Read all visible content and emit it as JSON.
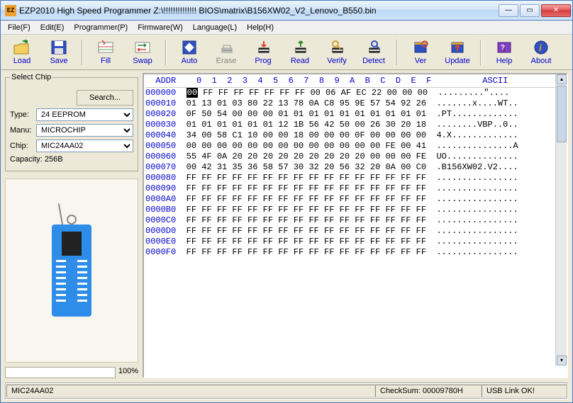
{
  "title": "EZP2010 High Speed Programmer   Z:\\!!!!!!!!!!!!!! BIOS\\matrix\\B156XW02_V2_Lenovo_B550.bin",
  "menu": [
    "File(F)",
    "Edit(E)",
    "Programmer(P)",
    "Firmware(W)",
    "Language(L)",
    "Help(H)"
  ],
  "tools": {
    "load": "Load",
    "save": "Save",
    "fill": "Fill",
    "swap": "Swap",
    "auto": "Auto",
    "erase": "Erase",
    "prog": "Prog",
    "read": "Read",
    "verify": "Verify",
    "detect": "Detect",
    "ver": "Ver",
    "update": "Update",
    "help": "Help",
    "about": "About"
  },
  "select": {
    "legend": "Select Chip",
    "search": "Search...",
    "type_label": "Type:",
    "type": "24 EEPROM",
    "manu_label": "Manu:",
    "manu": "MICROCHIP",
    "chip_label": "Chip:",
    "chip": "MIC24AA02",
    "capacity": "Capacity: 256B"
  },
  "progress": "100%",
  "hex": {
    "header": [
      "ADDR",
      "0",
      "1",
      "2",
      "3",
      "4",
      "5",
      "6",
      "7",
      "8",
      "9",
      "A",
      "B",
      "C",
      "D",
      "E",
      "F",
      "ASCII"
    ],
    "rows": [
      {
        "a": "000000",
        "b": [
          "00",
          "FF",
          "FF",
          "FF",
          "FF",
          "FF",
          "FF",
          "FF",
          "00",
          "06",
          "AF",
          "EC",
          "22",
          "00",
          "00",
          "00"
        ],
        "t": ".........\"...."
      },
      {
        "a": "000010",
        "b": [
          "01",
          "13",
          "01",
          "03",
          "80",
          "22",
          "13",
          "78",
          "0A",
          "C8",
          "95",
          "9E",
          "57",
          "54",
          "92",
          "26"
        ],
        "t": ".......x....WT.."
      },
      {
        "a": "000020",
        "b": [
          "0F",
          "50",
          "54",
          "00",
          "00",
          "00",
          "01",
          "01",
          "01",
          "01",
          "01",
          "01",
          "01",
          "01",
          "01",
          "01"
        ],
        "t": ".PT............."
      },
      {
        "a": "000030",
        "b": [
          "01",
          "01",
          "01",
          "01",
          "01",
          "01",
          "12",
          "1B",
          "56",
          "42",
          "50",
          "00",
          "26",
          "30",
          "20",
          "18"
        ],
        "t": "........VBP..0.."
      },
      {
        "a": "000040",
        "b": [
          "34",
          "00",
          "58",
          "C1",
          "10",
          "00",
          "00",
          "18",
          "00",
          "00",
          "00",
          "0F",
          "00",
          "00",
          "00",
          "00"
        ],
        "t": "4.X............."
      },
      {
        "a": "000050",
        "b": [
          "00",
          "00",
          "00",
          "00",
          "00",
          "00",
          "00",
          "00",
          "00",
          "00",
          "00",
          "00",
          "00",
          "FE",
          "00",
          "41"
        ],
        "t": "...............A"
      },
      {
        "a": "000060",
        "b": [
          "55",
          "4F",
          "0A",
          "20",
          "20",
          "20",
          "20",
          "20",
          "20",
          "20",
          "20",
          "20",
          "00",
          "00",
          "00",
          "FE"
        ],
        "t": "UO.............."
      },
      {
        "a": "000070",
        "b": [
          "00",
          "42",
          "31",
          "35",
          "36",
          "58",
          "57",
          "30",
          "32",
          "20",
          "56",
          "32",
          "20",
          "0A",
          "00",
          "C0"
        ],
        "t": ".B156XW02.V2...."
      },
      {
        "a": "000080",
        "b": [
          "FF",
          "FF",
          "FF",
          "FF",
          "FF",
          "FF",
          "FF",
          "FF",
          "FF",
          "FF",
          "FF",
          "FF",
          "FF",
          "FF",
          "FF",
          "FF"
        ],
        "t": "................"
      },
      {
        "a": "000090",
        "b": [
          "FF",
          "FF",
          "FF",
          "FF",
          "FF",
          "FF",
          "FF",
          "FF",
          "FF",
          "FF",
          "FF",
          "FF",
          "FF",
          "FF",
          "FF",
          "FF"
        ],
        "t": "................"
      },
      {
        "a": "0000A0",
        "b": [
          "FF",
          "FF",
          "FF",
          "FF",
          "FF",
          "FF",
          "FF",
          "FF",
          "FF",
          "FF",
          "FF",
          "FF",
          "FF",
          "FF",
          "FF",
          "FF"
        ],
        "t": "................"
      },
      {
        "a": "0000B0",
        "b": [
          "FF",
          "FF",
          "FF",
          "FF",
          "FF",
          "FF",
          "FF",
          "FF",
          "FF",
          "FF",
          "FF",
          "FF",
          "FF",
          "FF",
          "FF",
          "FF"
        ],
        "t": "................"
      },
      {
        "a": "0000C0",
        "b": [
          "FF",
          "FF",
          "FF",
          "FF",
          "FF",
          "FF",
          "FF",
          "FF",
          "FF",
          "FF",
          "FF",
          "FF",
          "FF",
          "FF",
          "FF",
          "FF"
        ],
        "t": "................"
      },
      {
        "a": "0000D0",
        "b": [
          "FF",
          "FF",
          "FF",
          "FF",
          "FF",
          "FF",
          "FF",
          "FF",
          "FF",
          "FF",
          "FF",
          "FF",
          "FF",
          "FF",
          "FF",
          "FF"
        ],
        "t": "................"
      },
      {
        "a": "0000E0",
        "b": [
          "FF",
          "FF",
          "FF",
          "FF",
          "FF",
          "FF",
          "FF",
          "FF",
          "FF",
          "FF",
          "FF",
          "FF",
          "FF",
          "FF",
          "FF",
          "FF"
        ],
        "t": "................"
      },
      {
        "a": "0000F0",
        "b": [
          "FF",
          "FF",
          "FF",
          "FF",
          "FF",
          "FF",
          "FF",
          "FF",
          "FF",
          "FF",
          "FF",
          "FF",
          "FF",
          "FF",
          "FF",
          "FF"
        ],
        "t": "................"
      }
    ]
  },
  "status": {
    "chip": "MIC24AA02",
    "checksum": "CheckSum: 00009780H",
    "usb": "USB Link OK!"
  }
}
